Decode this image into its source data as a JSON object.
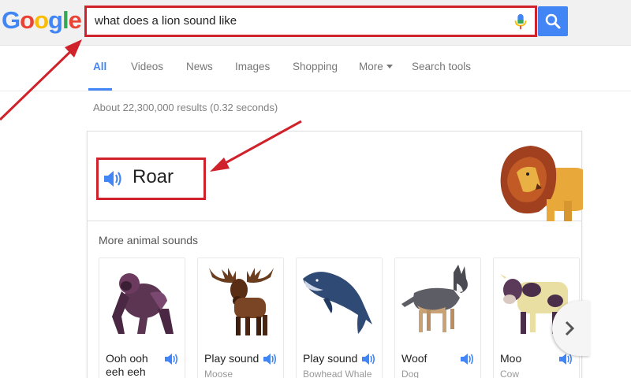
{
  "logo": {
    "letters": [
      {
        "char": "G",
        "color": "#4285f4"
      },
      {
        "char": "o",
        "color": "#ea4335"
      },
      {
        "char": "o",
        "color": "#fbbc05"
      },
      {
        "char": "g",
        "color": "#4285f4"
      },
      {
        "char": "l",
        "color": "#34a853"
      },
      {
        "char": "e",
        "color": "#ea4335"
      }
    ]
  },
  "search": {
    "query": "what does a lion sound like",
    "button_icon": "search-icon",
    "mic_icon": "mic-icon"
  },
  "tabs": {
    "all": "All",
    "videos": "Videos",
    "news": "News",
    "images": "Images",
    "shopping": "Shopping",
    "more": "More",
    "search_tools": "Search tools"
  },
  "result_stats": "About 22,300,000 results (0.32 seconds)",
  "answer": {
    "text": "Roar",
    "icon": "speaker-icon"
  },
  "more_sounds": {
    "title": "More animal sounds",
    "tiles": [
      {
        "label": "Ooh ooh eeh eeh",
        "sub": "",
        "icon": "gorilla"
      },
      {
        "label": "Play sound",
        "sub": "Moose",
        "icon": "moose"
      },
      {
        "label": "Play sound",
        "sub": "Bowhead Whale",
        "icon": "whale"
      },
      {
        "label": "Woof",
        "sub": "Dog",
        "icon": "dog"
      },
      {
        "label": "Moo",
        "sub": "Cow",
        "icon": "cow"
      }
    ]
  },
  "colors": {
    "accent": "#4285f4",
    "annotation": "#d0222a"
  }
}
